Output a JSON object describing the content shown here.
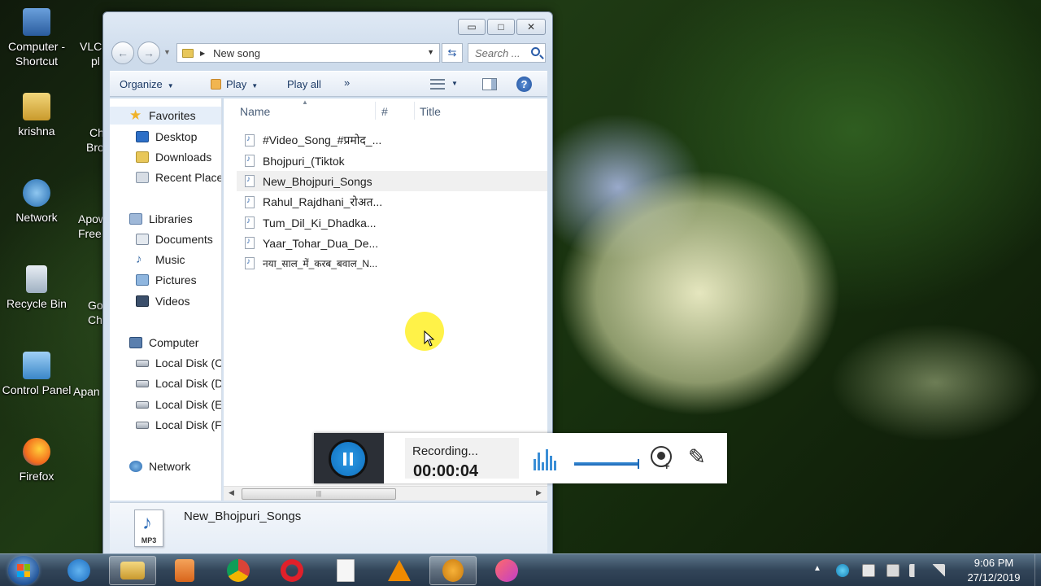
{
  "desktop": {
    "icons": [
      {
        "label_line1": "Computer -",
        "label_line2": "Shortcut"
      },
      {
        "label_line1": "krishna",
        "label_line2": ""
      },
      {
        "label_line1": "Network",
        "label_line2": ""
      },
      {
        "label_line1": "Recycle Bin",
        "label_line2": ""
      },
      {
        "label_line1": "Control Panel",
        "label_line2": ""
      },
      {
        "label_line1": "Firefox",
        "label_line2": ""
      }
    ],
    "partial_icons": [
      {
        "line1": "VLC",
        "line2": "pl"
      },
      {
        "line1": "Ch",
        "line2": "Bro"
      },
      {
        "line1": "Apow",
        "line2": "Free"
      },
      {
        "line1": "Go",
        "line2": "Chr"
      },
      {
        "line1": "Apan",
        "line2": ""
      }
    ]
  },
  "explorer": {
    "window_buttons": {
      "minimize": "▭",
      "maximize": "□",
      "close": "✕"
    },
    "address": {
      "path": "New song"
    },
    "search": {
      "placeholder": "Search ..."
    },
    "toolbar": {
      "organize": "Organize",
      "play": "Play",
      "play_all": "Play all",
      "more": "»"
    },
    "nav": {
      "favorites": "Favorites",
      "desktop": "Desktop",
      "downloads": "Downloads",
      "recent": "Recent Places",
      "libraries": "Libraries",
      "documents": "Documents",
      "music": "Music",
      "pictures": "Pictures",
      "videos": "Videos",
      "computer": "Computer",
      "disk_c": "Local Disk (C:",
      "disk_d": "Local Disk (D",
      "disk_e": "Local Disk (E:",
      "disk_f": "Local Disk (F:",
      "network": "Network"
    },
    "columns": {
      "name": "Name",
      "number": "#",
      "title": "Title"
    },
    "files": [
      "#Video_Song_#प्रमोद_...",
      "Bhojpuri_(Tiktok",
      "New_Bhojpuri_Songs",
      "Rahul_Rajdhani_रोअत...",
      "Tum_Dil_Ki_Dhadka...",
      "Yaar_Tohar_Dua_De...",
      "नया_साल_में_करब_बवाल_N..."
    ],
    "selected_file_index": 2,
    "details": {
      "name": "New_Bhojpuri_Songs",
      "icon_label": "MP3"
    }
  },
  "recorder": {
    "status": "Recording...",
    "timer": "00:00:04"
  },
  "taskbar": {
    "clock_time": "9:06 PM",
    "clock_date": "27/12/2019"
  }
}
